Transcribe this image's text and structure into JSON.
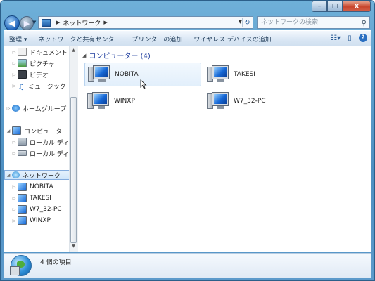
{
  "window": {
    "caption": {
      "minimize": "–",
      "maximize": "□",
      "close": "x"
    }
  },
  "address": {
    "crumb": "ネットワーク",
    "search_placeholder": "ネットワークの検索"
  },
  "toolbar": {
    "items": [
      "整理 ▾",
      "ネットワークと共有センター",
      "プリンターの追加",
      "ワイヤレス デバイスの追加"
    ]
  },
  "navpane": {
    "items": [
      {
        "label": "ドキュメント",
        "icon": "documents-icon"
      },
      {
        "label": "ピクチャ",
        "icon": "pictures-icon"
      },
      {
        "label": "ビデオ",
        "icon": "videos-icon"
      },
      {
        "label": "ミュージック",
        "icon": "music-icon"
      },
      {
        "label": "ホームグループ",
        "icon": "homegroup-icon"
      },
      {
        "label": "コンピューター",
        "icon": "computer-icon"
      },
      {
        "label": "ローカル ディス",
        "icon": "local-disk-icon"
      },
      {
        "label": "ローカル ディス",
        "icon": "local-disk-icon"
      },
      {
        "label": "ネットワーク",
        "icon": "network-icon"
      },
      {
        "label": "NOBITA",
        "icon": "computer-icon"
      },
      {
        "label": "TAKESI",
        "icon": "computer-icon"
      },
      {
        "label": "W7_32-PC",
        "icon": "computer-icon"
      },
      {
        "label": "WINXP",
        "icon": "computer-icon"
      }
    ]
  },
  "content": {
    "group_header": "コンピューター (4)",
    "computers": [
      "NOBITA",
      "TAKESI",
      "WINXP",
      "W7_32-PC"
    ]
  },
  "details": {
    "count_text": "4 個の項目"
  },
  "colors": {
    "frame": "#4e8fc1",
    "group_header": "#1e3d9e",
    "selection": "#cfe5fa"
  }
}
